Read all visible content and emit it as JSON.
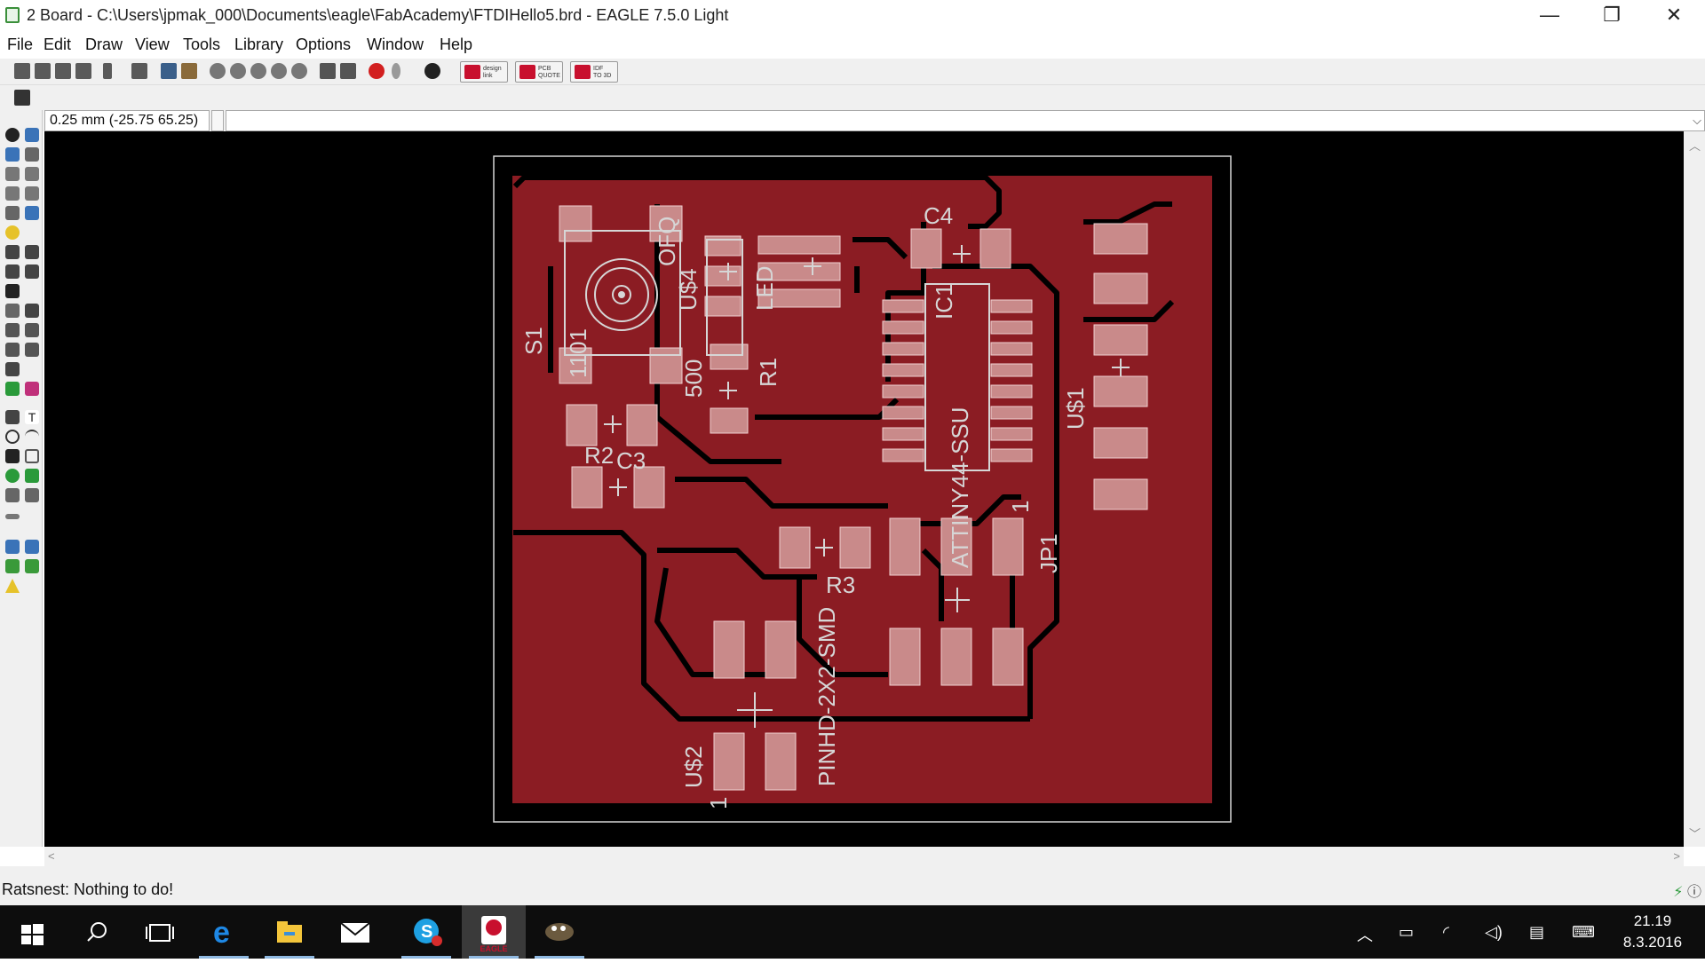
{
  "window": {
    "title": "2 Board - C:\\Users\\jpmak_000\\Documents\\eagle\\FabAcademy\\FTDIHello5.brd - EAGLE 7.5.0 Light",
    "controls": [
      "—",
      "❐",
      "✕"
    ]
  },
  "menu": [
    "File",
    "Edit",
    "Draw",
    "View",
    "Tools",
    "Library",
    "Options",
    "Window",
    "Help"
  ],
  "toolbar_buttons": {
    "design_link": [
      "design",
      "link"
    ],
    "pcb_quote": [
      "PCB",
      "QUOTE"
    ],
    "idf_to_3d": [
      "IDF",
      "TO 3D"
    ]
  },
  "command": {
    "coordinate": "0.25 mm (-25.75 65.25)",
    "value": ""
  },
  "board": {
    "labels": {
      "S1": "S1",
      "C4": "C4",
      "R1": "R1",
      "val500": "500",
      "LED": "LED",
      "US4": "U$4",
      "US1": "U$1",
      "US2": "U$2",
      "R2": "R2",
      "C3": "C3",
      "R3": "R3",
      "IC1": "IC1",
      "ATTINY": "ATTINY44-SSU",
      "JP1": "JP1",
      "PINHD": "PINHD-2X2-SMD",
      "pin1a": "1",
      "pin1b": "1",
      "sw1": "OFQ",
      "sw2": "1101"
    },
    "colors": {
      "copper": "#8b1c23",
      "pad": "#c98a8a",
      "silk": "#d6d6d6",
      "bg": "#000000"
    }
  },
  "status": {
    "message": "Ratsnest: Nothing to do!"
  },
  "taskbar": {
    "apps": [
      "start-icon",
      "search-icon",
      "task-view-icon",
      "edge-icon",
      "file-explorer-icon",
      "mail-icon",
      "skype-icon",
      "eagle-icon",
      "gimp-icon"
    ],
    "eagle_label": "EAGLE",
    "time": "21.19",
    "date": "8.3.2016"
  }
}
